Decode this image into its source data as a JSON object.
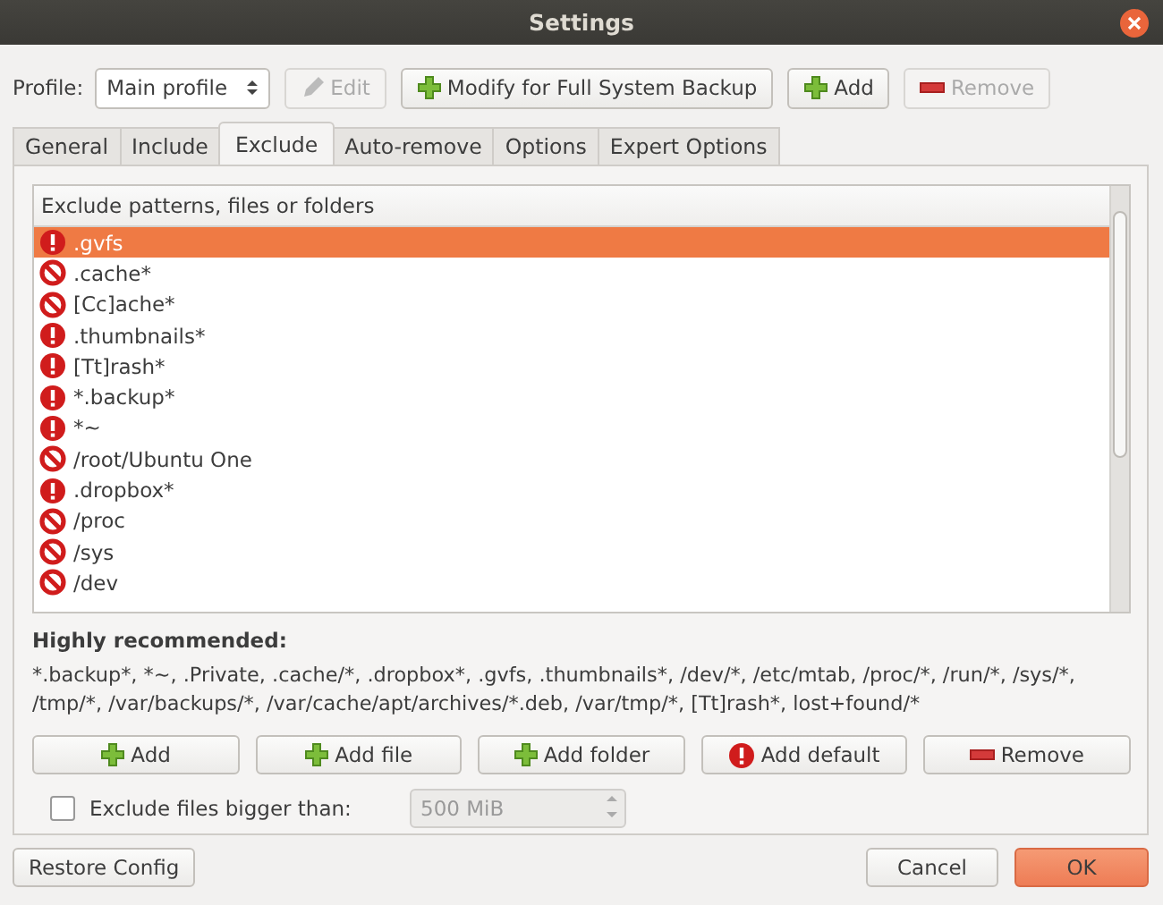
{
  "window": {
    "title": "Settings"
  },
  "profile": {
    "label": "Profile:",
    "value": "Main profile"
  },
  "toolbar": [
    {
      "kind": "edit",
      "label": "Edit",
      "disabled": true
    },
    {
      "kind": "add",
      "label": "Modify for Full System Backup",
      "disabled": false
    },
    {
      "kind": "add",
      "label": "Add",
      "disabled": false
    },
    {
      "kind": "remove",
      "label": "Remove",
      "disabled": true
    }
  ],
  "tabs": [
    {
      "label": "General",
      "selected": false
    },
    {
      "label": "Include",
      "selected": false
    },
    {
      "label": "Exclude",
      "selected": true
    },
    {
      "label": "Auto-remove",
      "selected": false
    },
    {
      "label": "Options",
      "selected": false
    },
    {
      "label": "Expert Options",
      "selected": false
    }
  ],
  "exclude_list": {
    "header": "Exclude patterns, files or folders",
    "rows": [
      {
        "kind": "warning",
        "text": ".gvfs",
        "selected": true
      },
      {
        "kind": "blocked",
        "text": ".cache*",
        "selected": false
      },
      {
        "kind": "blocked",
        "text": "[Cc]ache*",
        "selected": false
      },
      {
        "kind": "warning",
        "text": ".thumbnails*",
        "selected": false
      },
      {
        "kind": "warning",
        "text": "[Tt]rash*",
        "selected": false
      },
      {
        "kind": "warning",
        "text": "*.backup*",
        "selected": false
      },
      {
        "kind": "warning",
        "text": "*~",
        "selected": false
      },
      {
        "kind": "blocked",
        "text": "/root/Ubuntu One",
        "selected": false
      },
      {
        "kind": "warning",
        "text": ".dropbox*",
        "selected": false
      },
      {
        "kind": "blocked",
        "text": "/proc",
        "selected": false
      },
      {
        "kind": "blocked",
        "text": "/sys",
        "selected": false
      },
      {
        "kind": "blocked",
        "text": "/dev",
        "selected": false
      }
    ]
  },
  "recommended": {
    "title": "Highly recommended:",
    "text": "*.backup*, *~, .Private, .cache/*, .dropbox*, .gvfs, .thumbnails*, /dev/*, /etc/mtab, /proc/*, /run/*, /sys/*, /tmp/*, /var/backups/*, /var/cache/apt/archives/*.deb, /var/tmp/*, [Tt]rash*, lost+found/*"
  },
  "list_buttons": [
    {
      "kind": "add",
      "label": "Add"
    },
    {
      "kind": "add",
      "label": "Add file"
    },
    {
      "kind": "add",
      "label": "Add folder"
    },
    {
      "kind": "warning",
      "label": "Add default"
    },
    {
      "kind": "remove",
      "label": "Remove"
    }
  ],
  "size_limit": {
    "label": "Exclude files bigger than:",
    "checked": false,
    "value": "500 MiB",
    "disabled": true
  },
  "footer": {
    "restore": "Restore Config",
    "cancel": "Cancel",
    "ok": "OK"
  }
}
